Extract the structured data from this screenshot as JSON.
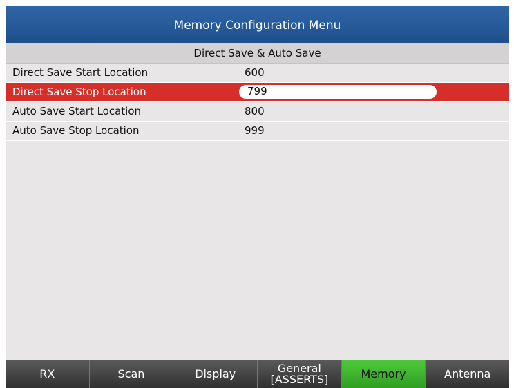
{
  "window": {
    "title": "Memory Configuration Menu"
  },
  "section": {
    "title": "Direct Save & Auto Save"
  },
  "settings": [
    {
      "label": "Direct Save Start Location",
      "value": "600"
    },
    {
      "label": "Direct Save Stop Location",
      "value": "799"
    },
    {
      "label": "Auto Save Start Location",
      "value": "800"
    },
    {
      "label": "Auto Save Stop Location",
      "value": "999"
    }
  ],
  "tabs": [
    {
      "label": "RX"
    },
    {
      "label": "Scan"
    },
    {
      "label": "Display"
    },
    {
      "label": "General",
      "sublabel": "[ASSERTS]"
    },
    {
      "label": "Memory"
    },
    {
      "label": "Antenna"
    }
  ],
  "colors": {
    "title_bar": "#2a5d9f",
    "selected_row": "#d62f2a",
    "active_tab": "#3cb52e",
    "tab": "#3a3a3a",
    "background": "#e8e6e6"
  }
}
